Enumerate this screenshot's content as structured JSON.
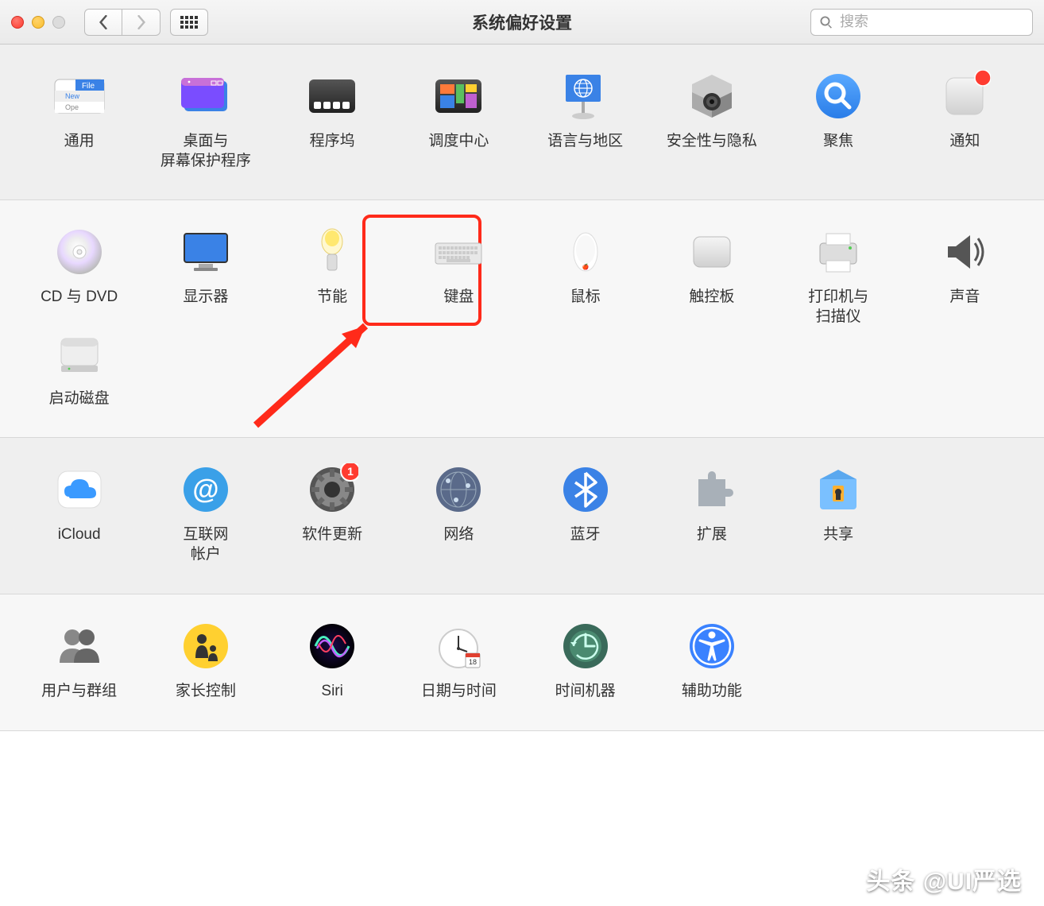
{
  "window": {
    "title": "系统偏好设置"
  },
  "search": {
    "placeholder": "搜索"
  },
  "sections": [
    {
      "style": "alt",
      "items": [
        {
          "key": "general",
          "label": "通用",
          "icon": "general-icon"
        },
        {
          "key": "desktop",
          "label": "桌面与\n屏幕保护程序",
          "icon": "desktop-icon"
        },
        {
          "key": "dock",
          "label": "程序坞",
          "icon": "dock-icon"
        },
        {
          "key": "mission",
          "label": "调度中心",
          "icon": "mission-icon"
        },
        {
          "key": "language",
          "label": "语言与地区",
          "icon": "language-icon"
        },
        {
          "key": "security",
          "label": "安全性与隐私",
          "icon": "security-icon"
        },
        {
          "key": "spotlight",
          "label": "聚焦",
          "icon": "spotlight-icon"
        },
        {
          "key": "notifications",
          "label": "通知",
          "icon": "notifications-icon",
          "notif": true
        }
      ]
    },
    {
      "style": "",
      "items": [
        {
          "key": "cd",
          "label": "CD 与 DVD",
          "icon": "cd-icon"
        },
        {
          "key": "displays",
          "label": "显示器",
          "icon": "displays-icon"
        },
        {
          "key": "energy",
          "label": "节能",
          "icon": "energy-icon"
        },
        {
          "key": "keyboard",
          "label": "键盘",
          "icon": "keyboard-icon",
          "highlight": true
        },
        {
          "key": "mouse",
          "label": "鼠标",
          "icon": "mouse-icon"
        },
        {
          "key": "trackpad",
          "label": "触控板",
          "icon": "trackpad-icon"
        },
        {
          "key": "printers",
          "label": "打印机与\n扫描仪",
          "icon": "printers-icon"
        },
        {
          "key": "sound",
          "label": "声音",
          "icon": "sound-icon"
        },
        {
          "key": "startup",
          "label": "启动磁盘",
          "icon": "startup-icon"
        }
      ]
    },
    {
      "style": "alt",
      "items": [
        {
          "key": "icloud",
          "label": "iCloud",
          "icon": "icloud-icon"
        },
        {
          "key": "internet",
          "label": "互联网\n帐户",
          "icon": "internet-icon"
        },
        {
          "key": "software",
          "label": "软件更新",
          "icon": "software-icon",
          "badge": "1"
        },
        {
          "key": "network",
          "label": "网络",
          "icon": "network-icon"
        },
        {
          "key": "bluetooth",
          "label": "蓝牙",
          "icon": "bluetooth-icon"
        },
        {
          "key": "extensions",
          "label": "扩展",
          "icon": "extensions-icon"
        },
        {
          "key": "sharing",
          "label": "共享",
          "icon": "sharing-icon"
        }
      ]
    },
    {
      "style": "",
      "items": [
        {
          "key": "users",
          "label": "用户与群组",
          "icon": "users-icon"
        },
        {
          "key": "parental",
          "label": "家长控制",
          "icon": "parental-icon"
        },
        {
          "key": "siri",
          "label": "Siri",
          "icon": "siri-icon"
        },
        {
          "key": "datetime",
          "label": "日期与时间",
          "icon": "datetime-icon"
        },
        {
          "key": "timemachine",
          "label": "时间机器",
          "icon": "timemachine-icon"
        },
        {
          "key": "accessibility",
          "label": "辅助功能",
          "icon": "accessibility-icon"
        }
      ]
    }
  ],
  "watermark": "头条 @UI严选"
}
